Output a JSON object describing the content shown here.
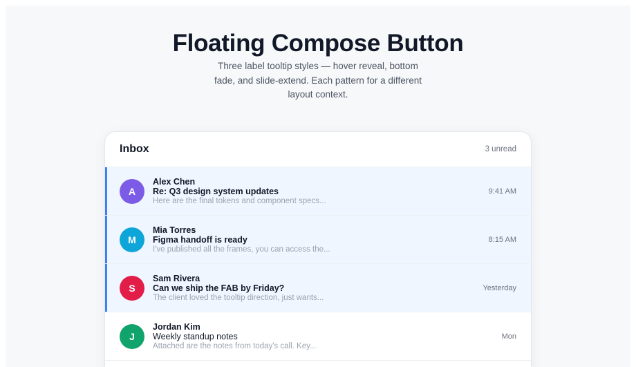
{
  "page": {
    "title": "Floating Compose Button",
    "subtitle": "Three label tooltip styles — hover reveal, bottom fade, and slide-extend. Each pattern for a different layout context."
  },
  "inbox": {
    "title": "Inbox",
    "unread_count": "3 unread",
    "accent_color": "#3b82f6",
    "messages": [
      {
        "initial": "A",
        "sender": "Alex Chen",
        "subject": "Re: Q3 design system updates",
        "preview": "Here are the final tokens and component specs...",
        "time": "9:41 AM",
        "unread": true,
        "avatar_color": "#7c5ce6"
      },
      {
        "initial": "M",
        "sender": "Mia Torres",
        "subject": "Figma handoff is ready",
        "preview": "I've published all the frames, you can access the...",
        "time": "8:15 AM",
        "unread": true,
        "avatar_color": "#0ea5d9"
      },
      {
        "initial": "S",
        "sender": "Sam Rivera",
        "subject": "Can we ship the FAB by Friday?",
        "preview": "The client loved the tooltip direction, just wants...",
        "time": "Yesterday",
        "unread": true,
        "avatar_color": "#e11d48"
      },
      {
        "initial": "J",
        "sender": "Jordan Kim",
        "subject": "Weekly standup notes",
        "preview": "Attached are the notes from today's call. Key...",
        "time": "Mon",
        "unread": false,
        "avatar_color": "#10a36b"
      }
    ]
  }
}
